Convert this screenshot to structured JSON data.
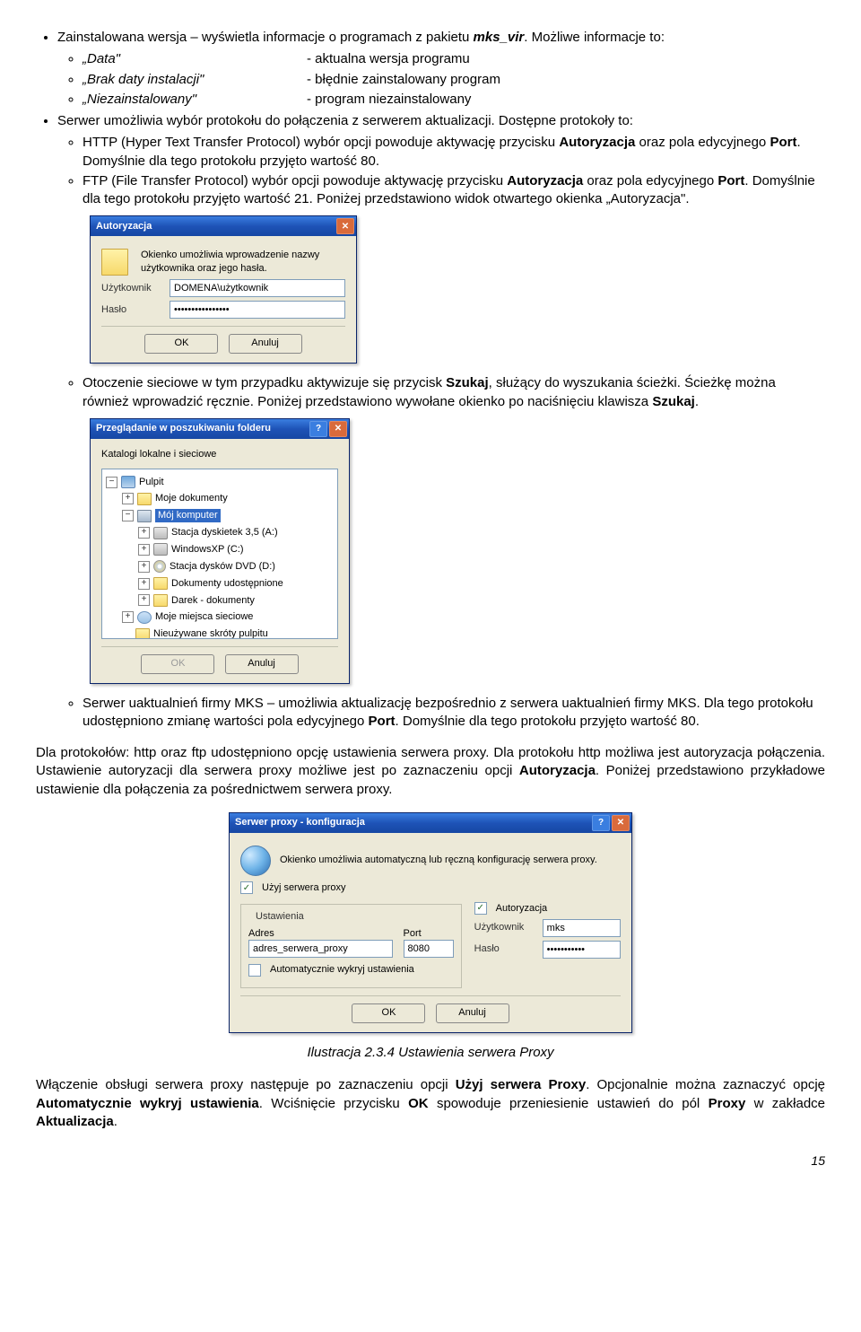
{
  "para1": {
    "pre": "Zainstalowana wersja – wyświetla informacje o programach z pakietu ",
    "em": "mks_vir",
    "post": ". Możliwe informacje to:"
  },
  "info_items": [
    {
      "term": "„Data\"",
      "desc": "- aktualna wersja programu"
    },
    {
      "term": "„Brak daty instalacji\"",
      "desc": "- błędnie zainstalowany program"
    },
    {
      "term": "„Niezainstalowany\"",
      "desc": "- program niezainstalowany"
    }
  ],
  "para2": "Serwer umożliwia wybór protokołu do połączenia z serwerem aktualizacji. Dostępne protokoły to:",
  "proto_http_a": "HTTP (Hyper Text Transfer Protocol) wybór opcji powoduje aktywację przycisku ",
  "proto_http_b": " oraz pola edycyjnego ",
  "proto_http_c": ". Domyślnie dla tego protokołu przyjęto wartość 80.",
  "proto_ftp_a": "FTP (File Transfer Protocol) wybór opcji powoduje aktywację przycisku ",
  "proto_ftp_b": " oraz pola edycyjnego ",
  "proto_ftp_c": ". Domyślnie dla tego protokołu przyjęto wartość 21. Poniżej przedstawiono widok otwartego okienka „Autoryzacja\".",
  "bold_autoryzacja": "Autoryzacja",
  "bold_port": "Port",
  "auth_dialog": {
    "title": "Autoryzacja",
    "intro": "Okienko umożliwia wprowadzenie nazwy użytkownika oraz jego hasła.",
    "user_label": "Użytkownik",
    "user_value": "DOMENA\\użytkownik",
    "pass_label": "Hasło",
    "pass_value": "••••••••••••••••",
    "ok": "OK",
    "cancel": "Anuluj"
  },
  "para3_a": "Otoczenie sieciowe w tym przypadku aktywizuje się przycisk ",
  "para3_b": ", służący do wyszukania ścieżki. Ścieżkę można również wprowadzić ręcznie. Poniżej przedstawiono wywołane okienko po naciśnięciu klawisza ",
  "para3_c": ".",
  "bold_szukaj": "Szukaj",
  "browse_dialog": {
    "title": "Przeglądanie w poszukiwaniu folderu",
    "subtitle": "Katalogi lokalne i sieciowe",
    "tree": {
      "desktop": "Pulpit",
      "mydocs": "Moje dokumenty",
      "mycomputer": "Mój komputer",
      "floppy": "Stacja dyskietek 3,5 (A:)",
      "c": "WindowsXP (C:)",
      "d": "Stacja dysków DVD (D:)",
      "shared": "Dokumenty udostępnione",
      "darek": "Darek - dokumenty",
      "network": "Moje miejsca sieciowe",
      "unused": "Nieużywane skróty pulpitu"
    },
    "ok": "OK",
    "cancel": "Anuluj"
  },
  "para4_a": "Serwer uaktualnień firmy MKS – umożliwia aktualizację bezpośrednio z serwera uaktualnień firmy MKS. Dla tego protokołu udostępniono zmianę wartości pola edycyjnego ",
  "para4_b": ". Domyślnie dla tego protokołu przyjęto wartość 80.",
  "para5_a": "Dla protokołów: http oraz ftp udostępniono opcję ustawienia serwera proxy. Dla protokołu http możliwa jest autoryzacja połączenia. Ustawienie autoryzacji dla serwera proxy możliwe jest po zaznaczeniu opcji ",
  "para5_b": ". Poniżej przedstawiono przykładowe ustawienie dla połączenia za pośrednictwem serwera proxy.",
  "proxy_dialog": {
    "title": "Serwer proxy - konfiguracja",
    "subtitle": "Okienko umożliwia automatyczną lub ręczną konfigurację serwera proxy.",
    "use_proxy": "Użyj serwera proxy",
    "settings": "Ustawienia",
    "address": "Adres",
    "address_value": "adres_serwera_proxy",
    "port": "Port",
    "port_value": "8080",
    "auto": "Automatycznie wykryj ustawienia",
    "auth": "Autoryzacja",
    "user_label": "Użytkownik",
    "user_value": "mks",
    "pass_label": "Hasło",
    "pass_value": "•••••••••••",
    "ok": "OK",
    "cancel": "Anuluj"
  },
  "caption": "Ilustracja 2.3.4 Ustawienia serwera Proxy",
  "para6_a": "Włączenie obsługi serwera proxy następuje po zaznaczeniu opcji ",
  "para6_b": ". Opcjonalnie można zaznaczyć opcję ",
  "para6_c": ". Wciśnięcie przycisku ",
  "para6_d": " spowoduje przeniesienie ustawień do pól ",
  "para6_e": " w zakładce ",
  "para6_f": ".",
  "bold_use_proxy": "Użyj serwera Proxy",
  "bold_autodetect": "Automatycznie wykryj ustawienia",
  "bold_ok": "OK",
  "bold_proxy": "Proxy",
  "bold_aktualizacja": "Aktualizacja",
  "page_number": "15"
}
